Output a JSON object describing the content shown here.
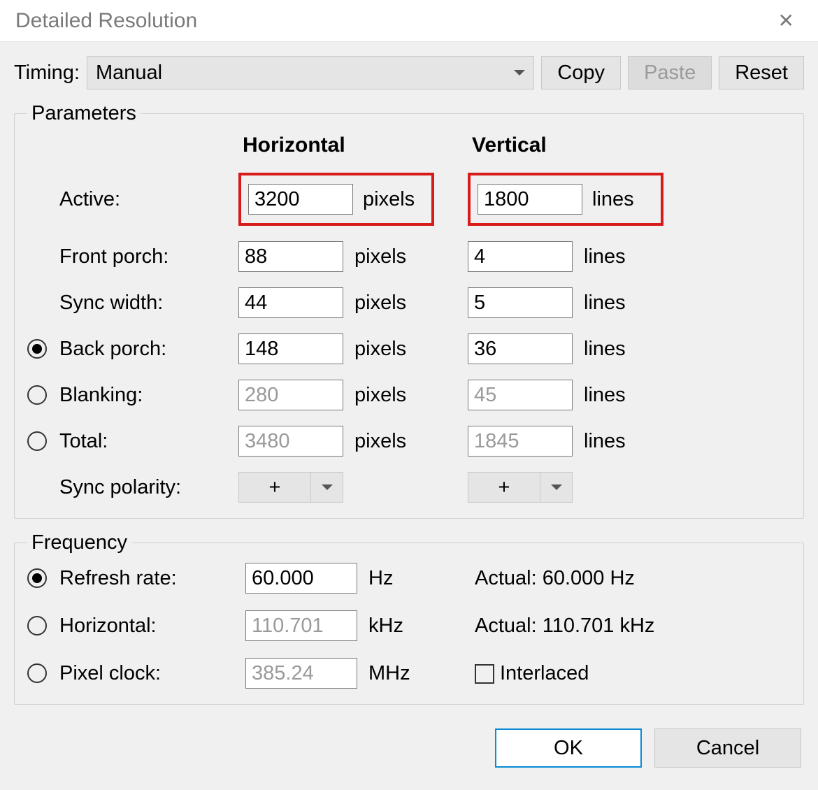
{
  "window": {
    "title": "Detailed Resolution"
  },
  "toolbar": {
    "timing_label": "Timing:",
    "timing_value": "Manual",
    "copy": "Copy",
    "paste": "Paste",
    "reset": "Reset"
  },
  "params": {
    "legend": "Parameters",
    "head_h": "Horizontal",
    "head_v": "Vertical",
    "rows": {
      "active": {
        "label": "Active:",
        "h": "3200",
        "hu": "pixels",
        "v": "1800",
        "vu": "lines",
        "highlight": true
      },
      "front_porch": {
        "label": "Front porch:",
        "h": "88",
        "hu": "pixels",
        "v": "4",
        "vu": "lines"
      },
      "sync_width": {
        "label": "Sync width:",
        "h": "44",
        "hu": "pixels",
        "v": "5",
        "vu": "lines"
      },
      "back_porch": {
        "label": "Back porch:",
        "h": "148",
        "hu": "pixels",
        "v": "36",
        "vu": "lines",
        "radio": "checked"
      },
      "blanking": {
        "label": "Blanking:",
        "h": "280",
        "hu": "pixels",
        "v": "45",
        "vu": "lines",
        "radio": "unchecked",
        "readonly": true
      },
      "total": {
        "label": "Total:",
        "h": "3480",
        "hu": "pixels",
        "v": "1845",
        "vu": "lines",
        "radio": "unchecked",
        "readonly": true
      },
      "sync_pol": {
        "label": "Sync polarity:",
        "h": "+",
        "v": "+"
      }
    }
  },
  "freq": {
    "legend": "Frequency",
    "refresh": {
      "label": "Refresh rate:",
      "val": "60.000",
      "unit": "Hz",
      "actual": "Actual: 60.000 Hz",
      "radio": "checked"
    },
    "horizontal": {
      "label": "Horizontal:",
      "val": "110.701",
      "unit": "kHz",
      "actual": "Actual: 110.701 kHz",
      "radio": "unchecked",
      "readonly": true
    },
    "pixelclock": {
      "label": "Pixel clock:",
      "val": "385.24",
      "unit": "MHz",
      "radio": "unchecked",
      "readonly": true
    },
    "interlaced_label": "Interlaced",
    "interlaced_checked": false
  },
  "actions": {
    "ok": "OK",
    "cancel": "Cancel"
  }
}
